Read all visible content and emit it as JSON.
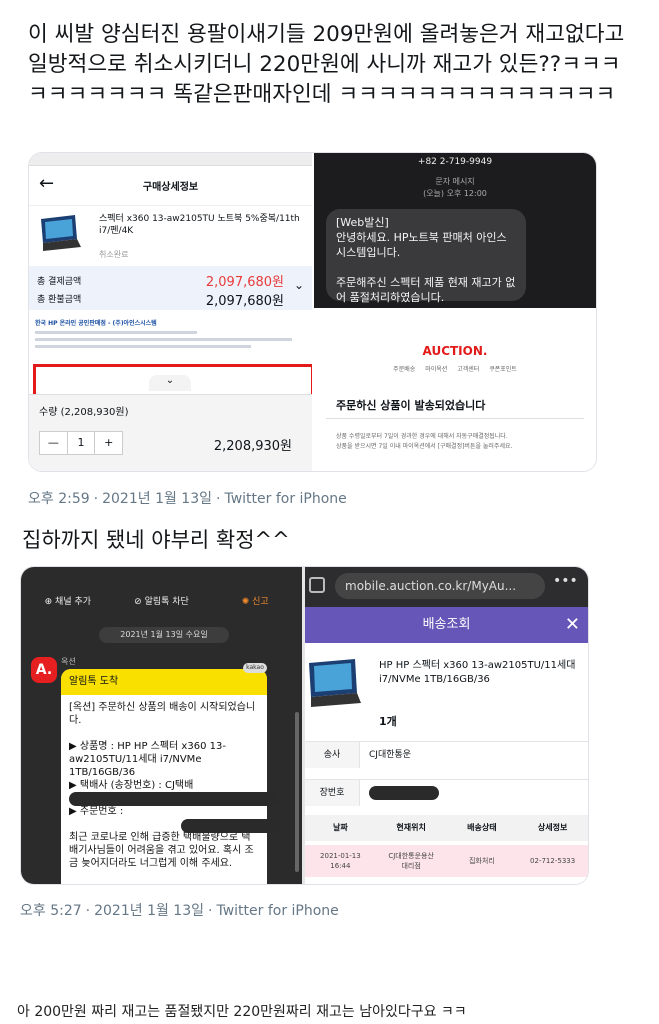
{
  "tweet1": {
    "text": "이 씨발 양심터진 용팔이새기들 209만원에 올려놓은거 재고없다고 일방적으로 취소시키더니 220만원에 사니까 재고가 있든??ㅋㅋㅋㅋㅋㅋㅋㅋㅋㅋ 똑같은판매자인데 ㅋㅋㅋㅋㅋㅋㅋㅋㅋㅋㅋㅋㅋㅋ",
    "time": "오후 2:59",
    "date": "2021년 1월 13일",
    "source": "Twitter for iPhone"
  },
  "order_screen": {
    "title": "구매상세정보",
    "product_name": "스펙터 x360 13-aw2105TU 노트북 5%중복/11th i7/펜/4K",
    "status": "취소완료",
    "total_pay_label": "총 결제금액",
    "total_pay_value": "2,097,680원",
    "total_refund_label": "총 환불금액",
    "total_refund_value": "2,097,680원",
    "seller_line": "한국 HP 온라인 공인판매점 - (주)아인스시스템"
  },
  "sms_screen": {
    "phone": "+82 2-719-9949",
    "meta": "문자 메시지\n(오늘) 오후 12:00",
    "message": "[Web발신]\n안녕하세요. HP노트북 판매처 아인스시스템입니다.\n\n주문해주신 스펙터 제품 현재 재고가 없어 품절처리하였습니다."
  },
  "qty_screen": {
    "label": "수량 (2,208,930원)",
    "minus": "—",
    "qty": "1",
    "plus": "+",
    "total": "2,208,930원"
  },
  "auction_mail": {
    "logo": "AUCTION.",
    "nav": [
      "주문배송",
      "마이옥션",
      "고객센터",
      "쿠폰포인트"
    ],
    "headline": "주문하신 상품이 발송되었습니다",
    "body": "상품 수령일로부터 7일이 경과한 경우에 대해서 자동구매결정됩니다.\n상품을 받으시면 7일 이내 마이옥션에서 [구매결정]버튼을 눌러주세요."
  },
  "tweet2": {
    "text": "집하까지 됐네 야부리 확정^^",
    "time": "오후 5:27",
    "date": "2021년 1월 13일",
    "source": "Twitter for iPhone"
  },
  "kakao_screen": {
    "toolbar": [
      "채널 추가",
      "알림톡 차단",
      "신고"
    ],
    "date": "2021년 1월 13일 수요일",
    "sender": "옥션",
    "avatar": "A.",
    "kakao_badge": "kakao",
    "card_header": "알림톡 도착",
    "card_body": "[옥션] 주문하신 상품의 배송이 시작되었습니다.\n\n▶ 상품명 : HP  HP  스펙터 x360 13-aw2105TU/11세대 i7/NVMe 1TB/16GB/36\n▶ 택배사 (송장번호) : CJ택배\n\n▶ 주문번호 :\n\n최근 코로나로 인해 급증한 택배물량으로 택배기사님들이 어려움을 겪고 있어요. 혹시 조금 늦어지더라도 너그럽게 이해 주세요."
  },
  "delivery_screen": {
    "url": "mobile.auction.co.kr/MyAu...",
    "title": "배송조회",
    "product": "HP HP 스펙터 x360 13-aw2105TU/11세대 i7/NVMe 1TB/16GB/36",
    "qty": "1개",
    "courier_label": "송사",
    "courier_value": "CJ대한통운",
    "invoice_label": "장번호",
    "table_headers": [
      "날짜",
      "현재위치",
      "배송상태",
      "상세정보"
    ],
    "table_row": [
      "2021-01-13\n16:44",
      "CJ대한통운용산\n대리점",
      "집화처리",
      "02-712-5333"
    ]
  },
  "footer_text": "아 200만원 짜리 재고는 품절됐지만 220만원짜리 재고는 남아있다구요 ㅋㅋ",
  "colors": {
    "accent_red": "#e21a1a",
    "kakao_yellow": "#f9e000",
    "auction_purple": "#6656b8",
    "meta_gray": "#657786"
  }
}
